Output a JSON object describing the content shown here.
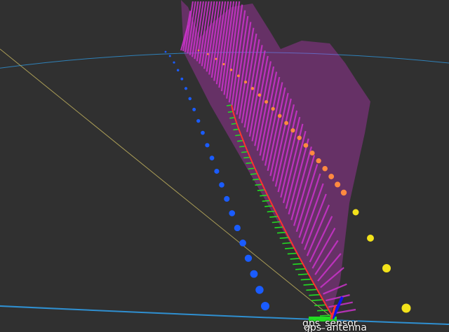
{
  "viewport": {
    "background_color": "#303030",
    "frame_labels": [
      "gps_sensor",
      "gps_antenna"
    ]
  },
  "colors": {
    "grid_ring": "#2f8fd0",
    "diagonal_line": "#c8b860",
    "blue_markers": "#1a5cff",
    "orange_markers": "#ff8a40",
    "yellow_markers": "#f2e21a",
    "magenta_arrows": "#cc33cc",
    "green_ticks": "#22dd22",
    "red_path": "#ff3030",
    "axis_blue": "#1010ee"
  },
  "visuals": {
    "point_clouds": [
      "blue-marker-trail",
      "orange-marker-trail",
      "yellow-marker-trail"
    ],
    "pose_array": "magenta-pose-arrows",
    "path": "red-odometry-path",
    "axes": "tf-frame-axes"
  }
}
